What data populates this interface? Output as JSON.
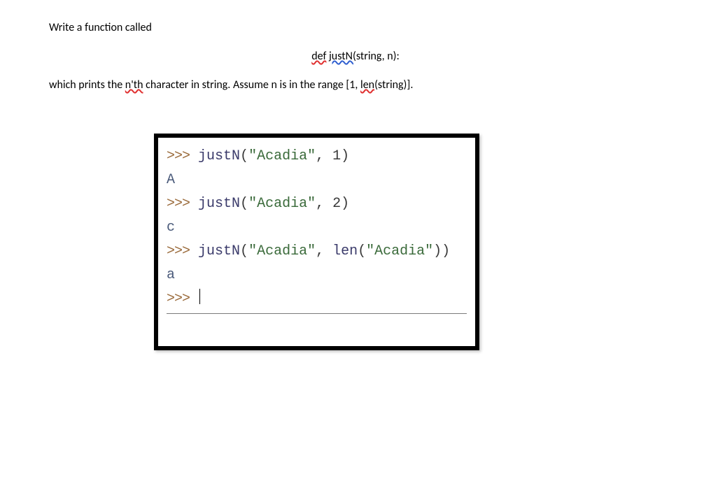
{
  "intro": {
    "pre": "Write a function called",
    "def_word": "def",
    "def_space": " ",
    "def_fn": "justN(",
    "def_args": "string, n):"
  },
  "desc": {
    "part1": "which prints the ",
    "nth": "n'th",
    "part2": " character in string. Assume n is in the range [1, ",
    "len": "len",
    "part3": "(string)]."
  },
  "console": {
    "prompt": ">>>",
    "fn": "justN",
    "lparen": "(",
    "comma": ", ",
    "rparen": ")",
    "arg_str": "\"Acadia\"",
    "arg1_n": "1",
    "out1": "A",
    "arg2_n": "2",
    "out2": "c",
    "arg3_len": "len",
    "out3": "a"
  }
}
